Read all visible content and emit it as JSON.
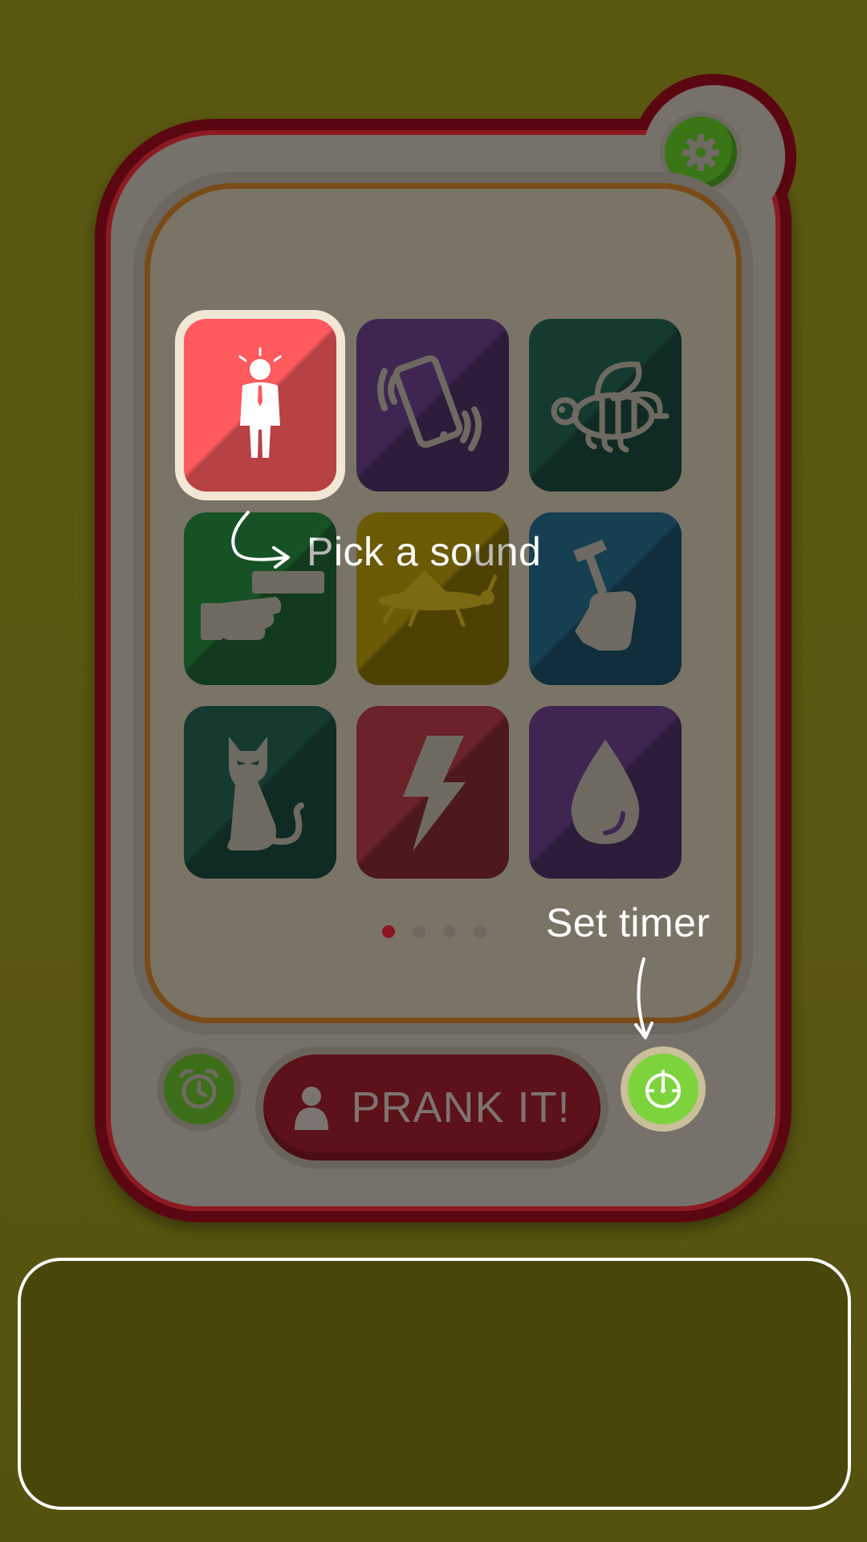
{
  "tiles": [
    {
      "name": "office-man",
      "color": "#ff5a5e",
      "selected": true
    },
    {
      "name": "vibrating-phone",
      "color": "#3f2652"
    },
    {
      "name": "bee",
      "color": "#153b30"
    },
    {
      "name": "hand-gun",
      "color": "#175226"
    },
    {
      "name": "grasshopper",
      "color": "#6b5a06"
    },
    {
      "name": "hammer-hand",
      "color": "#163f52"
    },
    {
      "name": "cat",
      "color": "#153b30"
    },
    {
      "name": "lightning",
      "color": "#6b2228"
    },
    {
      "name": "water-drop",
      "color": "#3f2652"
    }
  ],
  "hints": {
    "pick_sound": "Pick a sound",
    "set_timer": "Set timer"
  },
  "prank_button": {
    "label": "PRANK IT!"
  },
  "pagination": {
    "pages": 4,
    "active": 1
  },
  "colors": {
    "background": "#5a5810",
    "phone_border": "#5b0711",
    "selected_tile": "#ff5a5e",
    "timer_active": "#7dd33c"
  }
}
